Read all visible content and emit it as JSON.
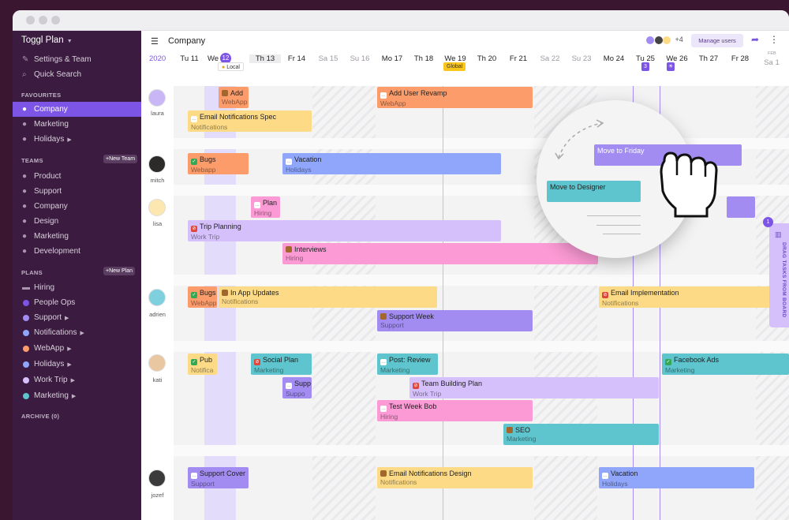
{
  "app": {
    "name": "Toggl Plan"
  },
  "sidebar": {
    "top_items": [
      {
        "label": "Settings & Team",
        "icon": "wrench-icon"
      },
      {
        "label": "Quick Search",
        "icon": "search-icon"
      }
    ],
    "favourites_heading": "FAVOURITES",
    "favourites": [
      {
        "label": "Company",
        "active": true
      },
      {
        "label": "Marketing"
      },
      {
        "label": "Holidays"
      }
    ],
    "teams_heading": "TEAMS",
    "new_team_label": "+New Team",
    "teams": [
      "Product",
      "Support",
      "Company",
      "Design",
      "Marketing",
      "Development"
    ],
    "plans_heading": "PLANS",
    "new_plan_label": "+New Plan",
    "plans": [
      {
        "label": "Hiring",
        "color": "#a28cf2"
      },
      {
        "label": "People Ops",
        "color": "#7c54e6"
      },
      {
        "label": "Support",
        "color": "#a28cf2"
      },
      {
        "label": "Notifications",
        "color": "#8fa6fb"
      },
      {
        "label": "WebApp",
        "color": "#fb9c6a"
      },
      {
        "label": "Holidays",
        "color": "#8fa6fb"
      },
      {
        "label": "Work Trip",
        "color": "#d5c0fb"
      },
      {
        "label": "Marketing",
        "color": "#5ec4cd"
      }
    ],
    "archive_label": "ARCHIVE (0)"
  },
  "header": {
    "title": "Company",
    "avatar_more": "+4",
    "manage_users": "Manage users"
  },
  "timeline": {
    "year": "2020",
    "today_num": "12",
    "days": [
      "Tu 11",
      "We",
      "Th 13",
      "Fr 14",
      "Sa 15",
      "Su 16",
      "Mo 17",
      "Th 18",
      "We 19",
      "Th 20",
      "Fr 21",
      "Sa 22",
      "Su 23",
      "Mo 24",
      "Tu 25",
      "We 26",
      "Th 27",
      "Fr 28",
      "Sa 1"
    ],
    "month_marker": "FEB",
    "badge_local": "Local",
    "badge_global": "Global",
    "badge_3": "3"
  },
  "users": [
    "laura",
    "mitch",
    "lisa",
    "adrien",
    "kati",
    "jozef"
  ],
  "tasks": [
    {
      "title": "Add",
      "sub": "WebApp"
    },
    {
      "title": "Add User Revamp",
      "sub": "WebApp"
    },
    {
      "title": "Email Notifications Spec",
      "sub": "Notifications"
    },
    {
      "title": "Bugs",
      "sub": "Webapp"
    },
    {
      "title": "Vacation",
      "sub": "Holidays"
    },
    {
      "title": "Plan",
      "sub": "Hiring"
    },
    {
      "title": "Trip Planning",
      "sub": "Work Trip"
    },
    {
      "title": "Interviews",
      "sub": "Hiring"
    },
    {
      "title": "Bugs",
      "sub": "WebApp"
    },
    {
      "title": "In App Updates",
      "sub": "Notifications"
    },
    {
      "title": "Email Implementation",
      "sub": "Notifications"
    },
    {
      "title": "Support Week",
      "sub": "Support"
    },
    {
      "title": "Pub",
      "sub": "Notifica"
    },
    {
      "title": "Social Plan",
      "sub": "Marketing"
    },
    {
      "title": "Post: Review",
      "sub": "Marketing"
    },
    {
      "title": "Facebook Ads",
      "sub": "Marketing"
    },
    {
      "title": "Supp",
      "sub": "Suppo"
    },
    {
      "title": "Team Building Plan",
      "sub": "Work Trip"
    },
    {
      "title": "Test Week Bob",
      "sub": "Hiring"
    },
    {
      "title": "SEO",
      "sub": "Marketing"
    },
    {
      "title": "Support Cover",
      "sub": "Support"
    },
    {
      "title": "Email Notifications Design",
      "sub": "Notifications"
    },
    {
      "title": "Vacation",
      "sub": "Holidays"
    }
  ],
  "overlay": {
    "move_friday": "Move to Friday",
    "move_designer": "Move to Designer"
  },
  "drag_panel": {
    "label": "DRAG TASKS FROM BOARD",
    "count": "1"
  }
}
